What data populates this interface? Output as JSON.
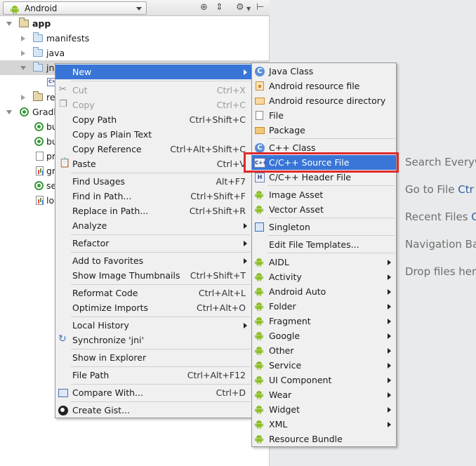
{
  "toolbar": {
    "view_label": "Android"
  },
  "tree": [
    {
      "label": "app",
      "bold": true
    },
    {
      "label": "manifests"
    },
    {
      "label": "java"
    },
    {
      "label": "jni"
    },
    {
      "label": ""
    },
    {
      "label": "re"
    },
    {
      "label": "Gradl"
    },
    {
      "label": "bu"
    },
    {
      "label": "bu"
    },
    {
      "label": "pr"
    },
    {
      "label": "gr"
    },
    {
      "label": "se"
    },
    {
      "label": "lo"
    }
  ],
  "hints": {
    "search": "Search Everyw",
    "goto_prefix": "Go to File ",
    "goto_key": "Ctr",
    "recent_prefix": "Recent Files ",
    "recent_key": "C",
    "navbar": "Navigation Ba",
    "drop": "Drop files her"
  },
  "context_menu": {
    "items": [
      {
        "label": "New",
        "shortcut": "",
        "submenu": true,
        "active": true
      },
      {
        "label": "Cut",
        "shortcut": "Ctrl+X",
        "disabled": true,
        "icon": "scissors-icon"
      },
      {
        "label": "Copy",
        "shortcut": "Ctrl+C",
        "disabled": true,
        "icon": "copy-icon"
      },
      {
        "label": "Copy Path",
        "shortcut": "Ctrl+Shift+C"
      },
      {
        "label": "Copy as Plain Text",
        "shortcut": ""
      },
      {
        "label": "Copy Reference",
        "shortcut": "Ctrl+Alt+Shift+C"
      },
      {
        "label": "Paste",
        "shortcut": "Ctrl+V",
        "icon": "clipboard-icon"
      },
      {
        "label": "Find Usages",
        "shortcut": "Alt+F7"
      },
      {
        "label": "Find in Path...",
        "shortcut": "Ctrl+Shift+F"
      },
      {
        "label": "Replace in Path...",
        "shortcut": "Ctrl+Shift+R"
      },
      {
        "label": "Analyze",
        "shortcut": "",
        "submenu": true
      },
      {
        "label": "Refactor",
        "shortcut": "",
        "submenu": true
      },
      {
        "label": "Add to Favorites",
        "shortcut": "",
        "submenu": true
      },
      {
        "label": "Show Image Thumbnails",
        "shortcut": "Ctrl+Shift+T"
      },
      {
        "label": "Reformat Code",
        "shortcut": "Ctrl+Alt+L"
      },
      {
        "label": "Optimize Imports",
        "shortcut": "Ctrl+Alt+O"
      },
      {
        "label": "Local History",
        "shortcut": "",
        "submenu": true
      },
      {
        "label": "Synchronize 'jni'",
        "shortcut": "",
        "icon": "sync-icon"
      },
      {
        "label": "Show in Explorer",
        "shortcut": ""
      },
      {
        "label": "File Path",
        "shortcut": "Ctrl+Alt+F12"
      },
      {
        "label": "Compare With...",
        "shortcut": "Ctrl+D",
        "icon": "compare-icon"
      },
      {
        "label": "Create Gist...",
        "shortcut": "",
        "icon": "github-icon"
      }
    ]
  },
  "new_submenu": {
    "items": [
      {
        "label": "Java Class",
        "icon": "java-class-icon"
      },
      {
        "label": "Android resource file",
        "icon": "resource-file-icon"
      },
      {
        "label": "Android resource directory",
        "icon": "resource-folder-icon"
      },
      {
        "label": "File",
        "icon": "file-icon"
      },
      {
        "label": "Package",
        "icon": "package-icon"
      },
      {
        "label": "C++ Class",
        "icon": "cpp-class-icon"
      },
      {
        "label": "C/C++ Source File",
        "icon": "cpp-source-icon",
        "active": true
      },
      {
        "label": "C/C++ Header File",
        "icon": "header-file-icon"
      },
      {
        "label": "Image Asset",
        "icon": "android-icon"
      },
      {
        "label": "Vector Asset",
        "icon": "android-icon"
      },
      {
        "label": "Singleton",
        "icon": "singleton-icon"
      },
      {
        "label": "Edit File Templates...",
        "icon": ""
      },
      {
        "label": "AIDL",
        "icon": "android-icon",
        "submenu": true
      },
      {
        "label": "Activity",
        "icon": "android-icon",
        "submenu": true
      },
      {
        "label": "Android Auto",
        "icon": "android-icon",
        "submenu": true
      },
      {
        "label": "Folder",
        "icon": "android-icon",
        "submenu": true
      },
      {
        "label": "Fragment",
        "icon": "android-icon",
        "submenu": true
      },
      {
        "label": "Google",
        "icon": "android-icon",
        "submenu": true
      },
      {
        "label": "Other",
        "icon": "android-icon",
        "submenu": true
      },
      {
        "label": "Service",
        "icon": "android-icon",
        "submenu": true
      },
      {
        "label": "UI Component",
        "icon": "android-icon",
        "submenu": true
      },
      {
        "label": "Wear",
        "icon": "android-icon",
        "submenu": true
      },
      {
        "label": "Widget",
        "icon": "android-icon",
        "submenu": true
      },
      {
        "label": "XML",
        "icon": "android-icon",
        "submenu": true
      },
      {
        "label": "Resource Bundle",
        "icon": "android-icon"
      }
    ]
  },
  "colors": {
    "menu_highlight": "#3875d7",
    "callout_border": "#e02a2a",
    "android_green": "#8cbf26"
  }
}
